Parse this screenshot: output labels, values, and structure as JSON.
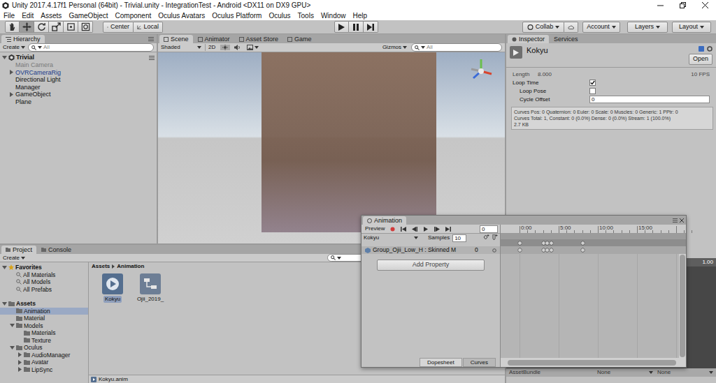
{
  "window": {
    "title": "Unity 2017.4.17f1 Personal (64bit) - Trivial.unity - IntegrationTest - Android <DX11 on DX9 GPU>"
  },
  "menu": [
    "File",
    "Edit",
    "Assets",
    "GameObject",
    "Component",
    "Oculus Avatars",
    "Oculus Platform",
    "Oculus",
    "Tools",
    "Window",
    "Help"
  ],
  "toolbar": {
    "tools": [
      {
        "kind": "hand",
        "selected": false
      },
      {
        "kind": "move",
        "selected": true
      },
      {
        "kind": "rotate",
        "selected": false
      },
      {
        "kind": "scale",
        "selected": false
      },
      {
        "kind": "rect",
        "selected": false
      },
      {
        "kind": "transform",
        "selected": false
      }
    ],
    "pivot": "Center",
    "space": "Local",
    "collab": "Collab",
    "account": "Account",
    "layers": "Layers",
    "layout": "Layout"
  },
  "hierarchy": {
    "tab": "Hierarchy",
    "create": "Create",
    "search": "All",
    "scene": "Trivial",
    "items": [
      {
        "name": "Main Camera",
        "expandable": false,
        "expanded": false,
        "disabled": true,
        "prefab": false
      },
      {
        "name": "OVRCameraRig",
        "expandable": true,
        "expanded": false,
        "disabled": false,
        "prefab": true
      },
      {
        "name": "Directional Light",
        "expandable": false,
        "expanded": false,
        "disabled": false,
        "prefab": false
      },
      {
        "name": "Manager",
        "expandable": false,
        "expanded": false,
        "disabled": false,
        "prefab": false
      },
      {
        "name": "GameObject",
        "expandable": true,
        "expanded": false,
        "disabled": false,
        "prefab": false
      },
      {
        "name": "Plane",
        "expandable": false,
        "expanded": false,
        "disabled": false,
        "prefab": false
      }
    ]
  },
  "scene": {
    "tabs": [
      {
        "label": "Scene",
        "selected": true
      },
      {
        "label": "Animator",
        "selected": false
      },
      {
        "label": "Asset Store",
        "selected": false
      },
      {
        "label": "Game",
        "selected": false
      }
    ],
    "shading": "Shaded",
    "mode": "2D",
    "lighting": true,
    "gizmos": "Gizmos",
    "search": "All"
  },
  "inspector": {
    "tabs": [
      {
        "label": "Inspector",
        "selected": true
      },
      {
        "label": "Services",
        "selected": false
      }
    ],
    "name": "Kokyu",
    "open": "Open",
    "length_label": "Length",
    "length": "8.000",
    "fps": "10 FPS",
    "fields": [
      {
        "label": "Loop Time",
        "kind": "checkbox",
        "checked": true,
        "value": ""
      },
      {
        "label": "Loop Pose",
        "kind": "checkbox",
        "checked": false,
        "value": ""
      },
      {
        "label": "Cycle Offset",
        "kind": "number",
        "checked": false,
        "value": "0"
      }
    ],
    "info": [
      "Curves Pos: 0 Quaternion: 0 Euler: 0 Scale: 0 Muscles: 0 Generic: 1 PPtr: 0",
      "Curves Total: 1, Constant: 0 (0.0%) Dense: 0 (0.0%) Stream: 1 (100.0%)",
      "2.7 KB"
    ],
    "preview_speed": "1.00",
    "asset_bundle": {
      "label": "AssetBundle",
      "values": [
        "None",
        "None"
      ]
    }
  },
  "project": {
    "tabs": [
      {
        "label": "Project",
        "selected": true
      },
      {
        "label": "Console",
        "selected": false
      }
    ],
    "create": "Create",
    "tree": [
      {
        "label": "Favorites",
        "depth": 0,
        "kind": "favorites",
        "expandable": true,
        "expanded": true,
        "selected": false
      },
      {
        "label": "All Materials",
        "depth": 1,
        "kind": "search",
        "expandable": false,
        "expanded": false,
        "selected": false
      },
      {
        "label": "All Models",
        "depth": 1,
        "kind": "search",
        "expandable": false,
        "expanded": false,
        "selected": false
      },
      {
        "label": "All Prefabs",
        "depth": 1,
        "kind": "search",
        "expandable": false,
        "expanded": false,
        "selected": false
      },
      {
        "label": "Assets",
        "depth": 0,
        "kind": "root",
        "expandable": true,
        "expanded": true,
        "selected": false
      },
      {
        "label": "Animation",
        "depth": 1,
        "kind": "folder",
        "expandable": false,
        "expanded": false,
        "selected": true
      },
      {
        "label": "Material",
        "depth": 1,
        "kind": "folder",
        "expandable": false,
        "expanded": false,
        "selected": false
      },
      {
        "label": "Models",
        "depth": 1,
        "kind": "folder",
        "expandable": true,
        "expanded": true,
        "selected": false
      },
      {
        "label": "Materials",
        "depth": 2,
        "kind": "folder",
        "expandable": false,
        "expanded": false,
        "selected": false
      },
      {
        "label": "Texture",
        "depth": 2,
        "kind": "folder",
        "expandable": false,
        "expanded": false,
        "selected": false
      },
      {
        "label": "Oculus",
        "depth": 1,
        "kind": "folder",
        "expandable": true,
        "expanded": true,
        "selected": false
      },
      {
        "label": "AudioManager",
        "depth": 2,
        "kind": "folder",
        "expandable": true,
        "expanded": false,
        "selected": false
      },
      {
        "label": "Avatar",
        "depth": 2,
        "kind": "folder",
        "expandable": true,
        "expanded": false,
        "selected": false
      },
      {
        "label": "LipSync",
        "depth": 2,
        "kind": "folder",
        "expandable": true,
        "expanded": false,
        "selected": false
      }
    ],
    "breadcrumb": [
      "Assets",
      "Animation"
    ],
    "assets": [
      {
        "name": "Kokyu",
        "kind": "clip",
        "selected": true
      },
      {
        "name": "Ojii_2019_",
        "kind": "controller",
        "selected": false
      }
    ],
    "footer": "Kokyu.anim"
  },
  "animation": {
    "title": "Animation",
    "preview": "Preview",
    "recording": false,
    "frame": "0",
    "clip": "Kokyu",
    "samples_label": "Samples",
    "samples": "10",
    "ticks": [
      "0:00",
      "5:00",
      "10:00",
      "15:00"
    ],
    "track": {
      "name": "Group_Ojii_Low_H : Skinned M",
      "value": "0"
    },
    "add_property": "Add Property",
    "keys": [
      0,
      3,
      3.5,
      4,
      8
    ],
    "tabs": [
      {
        "label": "Dopesheet",
        "selected": true
      },
      {
        "label": "Curves",
        "selected": false
      }
    ]
  }
}
